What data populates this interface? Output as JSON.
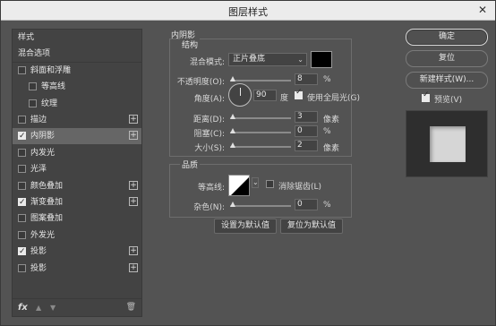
{
  "window": {
    "title": "图层样式",
    "close_label": "✕"
  },
  "left_panel": {
    "items": [
      {
        "label": "样式",
        "checkbox": null,
        "plus": false,
        "selected": false
      },
      {
        "label": "混合选项",
        "checkbox": null,
        "plus": false,
        "selected": false
      },
      {
        "label": "斜面和浮雕",
        "checkbox": false,
        "plus": false,
        "selected": false
      },
      {
        "label": "等高线",
        "checkbox": false,
        "plus": false,
        "selected": false
      },
      {
        "label": "纹理",
        "checkbox": false,
        "plus": false,
        "selected": false
      },
      {
        "label": "描边",
        "checkbox": false,
        "plus": true,
        "selected": false
      },
      {
        "label": "内阴影",
        "checkbox": true,
        "plus": true,
        "selected": true
      },
      {
        "label": "内发光",
        "checkbox": false,
        "plus": false,
        "selected": false
      },
      {
        "label": "光泽",
        "checkbox": false,
        "plus": false,
        "selected": false
      },
      {
        "label": "颜色叠加",
        "checkbox": false,
        "plus": true,
        "selected": false
      },
      {
        "label": "渐变叠加",
        "checkbox": true,
        "plus": true,
        "selected": false
      },
      {
        "label": "图案叠加",
        "checkbox": false,
        "plus": false,
        "selected": false
      },
      {
        "label": "外发光",
        "checkbox": false,
        "plus": false,
        "selected": false
      },
      {
        "label": "投影",
        "checkbox": true,
        "plus": true,
        "selected": false
      },
      {
        "label": "投影",
        "checkbox": false,
        "plus": true,
        "selected": false
      }
    ],
    "plus_symbol": "+",
    "footer": {
      "fx": "fx",
      "up": "▲",
      "down": "▼",
      "trash": "🗑"
    }
  },
  "inner_shadow": {
    "section_title": "内阴影",
    "structure": {
      "title": "结构",
      "blend_mode_label": "混合模式:",
      "blend_mode_value": "正片叠底",
      "color": "#000000",
      "opacity_label": "不透明度(O):",
      "opacity_value": "8",
      "opacity_unit": "%",
      "angle_label": "角度(A):",
      "angle_value": "90",
      "angle_unit": "度",
      "global_light_label": "使用全局光(G)",
      "global_light_checked": true,
      "distance_label": "距离(D):",
      "distance_value": "3",
      "distance_unit": "像素",
      "choke_label": "阻塞(C):",
      "choke_value": "0",
      "choke_unit": "%",
      "size_label": "大小(S):",
      "size_value": "2",
      "size_unit": "像素"
    },
    "quality": {
      "title": "品质",
      "contour_label": "等高线:",
      "anti_alias_label": "消除锯齿(L)",
      "anti_alias_checked": false,
      "noise_label": "杂色(N):",
      "noise_value": "0",
      "noise_unit": "%"
    },
    "buttons": {
      "set_default": "设置为默认值",
      "reset_default": "复位为默认值"
    }
  },
  "right_panel": {
    "ok": "确定",
    "reset": "复位",
    "new_style": "新建样式(W)...",
    "preview_label": "预览(V)",
    "preview_checked": true
  },
  "colors": {
    "dialog_bg": "#535353",
    "panel_bg": "#434343",
    "selected_row": "#666666"
  }
}
